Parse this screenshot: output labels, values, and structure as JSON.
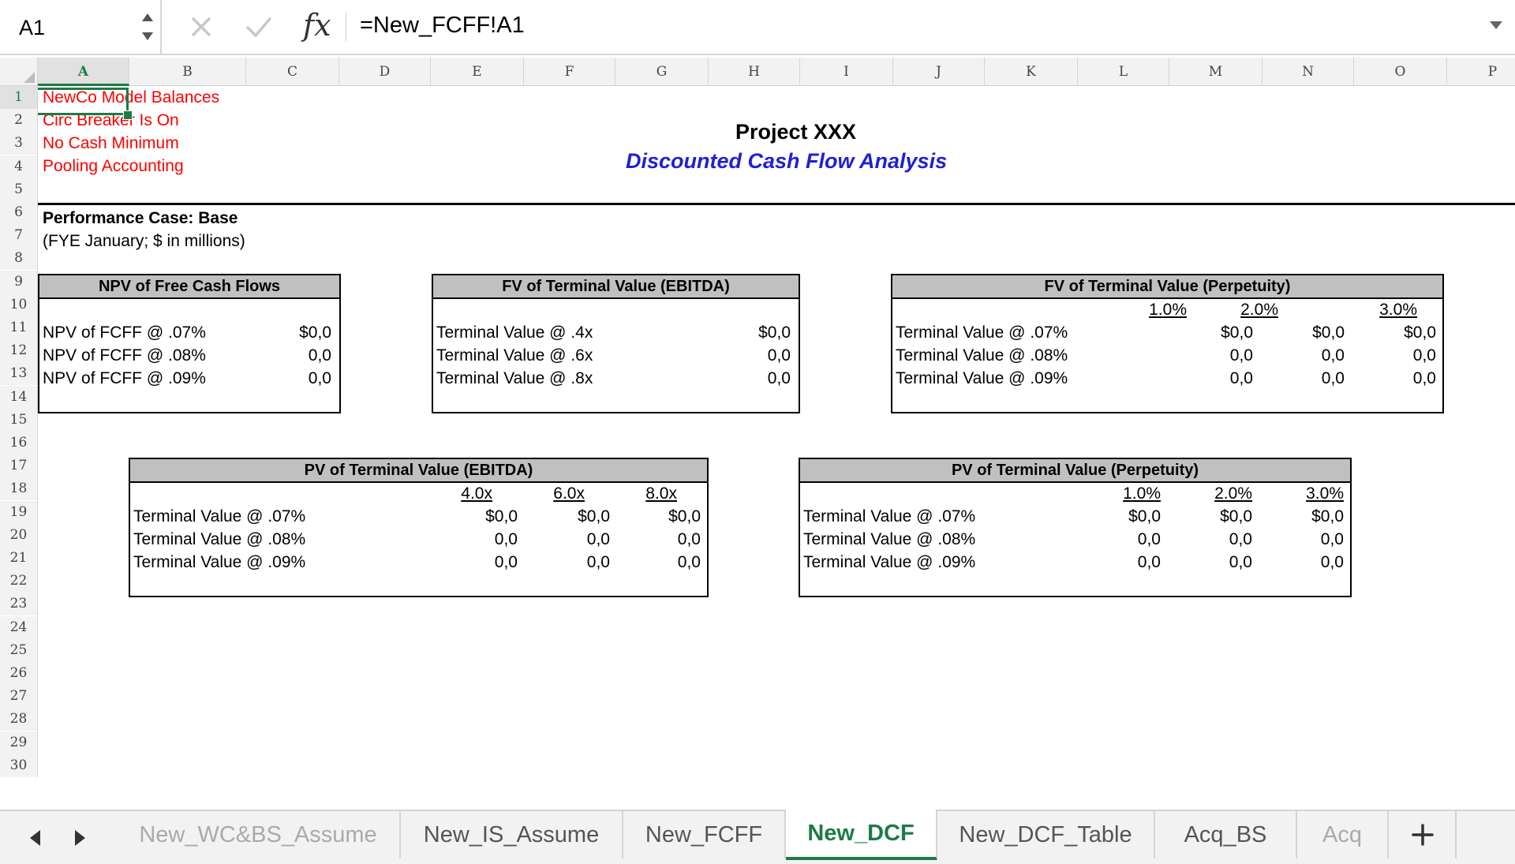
{
  "formula_bar": {
    "name_box": "A1",
    "formula": "=New_FCFF!A1",
    "fx_label": "fx"
  },
  "columns": [
    "A",
    "B",
    "C",
    "D",
    "E",
    "F",
    "G",
    "H",
    "I",
    "J",
    "K",
    "L",
    "M",
    "N",
    "O",
    "P"
  ],
  "rows": [
    "1",
    "2",
    "3",
    "4",
    "5",
    "6",
    "7",
    "8",
    "9",
    "10",
    "11",
    "12",
    "13",
    "14",
    "15",
    "16",
    "17",
    "18",
    "19",
    "20",
    "21",
    "22",
    "23",
    "24",
    "25",
    "26",
    "27",
    "28",
    "29",
    "30"
  ],
  "selected_cell": {
    "column": "A",
    "row": "1"
  },
  "header": {
    "line1": "NewCo Model Balances",
    "line2": "Circ Breaker Is On",
    "line3": "No Cash Minimum",
    "line4": "Pooling Accounting",
    "title": "Project XXX",
    "subtitle": "Discounted Cash Flow Analysis",
    "case": "Performance Case: Base",
    "units": "(FYE January; $ in millions)"
  },
  "npv_fcf": {
    "title": "NPV of Free Cash Flows",
    "rows": [
      {
        "label": "NPV of FCFF @ .07%",
        "value": "$0,0"
      },
      {
        "label": "NPV of FCFF @ .08%",
        "value": "0,0"
      },
      {
        "label": "NPV of FCFF @ .09%",
        "value": "0,0"
      }
    ]
  },
  "fv_tv_ebitda": {
    "title": "FV of Terminal Value (EBITDA)",
    "rows": [
      {
        "label": "Terminal Value @ .4x",
        "value": "$0,0"
      },
      {
        "label": "Terminal Value @ .6x",
        "value": "0,0"
      },
      {
        "label": "Terminal Value @ .8x",
        "value": "0,0"
      }
    ]
  },
  "fv_tv_perp": {
    "title": "FV of Terminal Value (Perpetuity)",
    "headers": [
      "1.0%",
      "2.0%",
      "3.0%"
    ],
    "rows": [
      {
        "label": "Terminal Value @ .07%",
        "values": [
          "$0,0",
          "$0,0",
          "$0,0"
        ]
      },
      {
        "label": "Terminal Value @ .08%",
        "values": [
          "0,0",
          "0,0",
          "0,0"
        ]
      },
      {
        "label": "Terminal Value @ .09%",
        "values": [
          "0,0",
          "0,0",
          "0,0"
        ]
      }
    ]
  },
  "pv_tv_ebitda": {
    "title": "PV of Terminal Value (EBITDA)",
    "headers": [
      "4.0x",
      "6.0x",
      "8.0x"
    ],
    "rows": [
      {
        "label": "Terminal Value @ .07%",
        "values": [
          "$0,0",
          "$0,0",
          "$0,0"
        ]
      },
      {
        "label": "Terminal Value @ .08%",
        "values": [
          "0,0",
          "0,0",
          "0,0"
        ]
      },
      {
        "label": "Terminal Value @ .09%",
        "values": [
          "0,0",
          "0,0",
          "0,0"
        ]
      }
    ]
  },
  "pv_tv_perp": {
    "title": "PV of Terminal Value (Perpetuity)",
    "headers": [
      "1.0%",
      "2.0%",
      "3.0%"
    ],
    "rows": [
      {
        "label": "Terminal Value @ .07%",
        "values": [
          "$0,0",
          "$0,0",
          "$0,0"
        ]
      },
      {
        "label": "Terminal Value @ .08%",
        "values": [
          "0,0",
          "0,0",
          "0,0"
        ]
      },
      {
        "label": "Terminal Value @ .09%",
        "values": [
          "0,0",
          "0,0",
          "0,0"
        ]
      }
    ]
  },
  "tabs": [
    "New_WC&BS_Assume",
    "New_IS_Assume",
    "New_FCFF",
    "New_DCF",
    "New_DCF_Table",
    "Acq_BS",
    "Acq"
  ],
  "active_tab": "New_DCF",
  "colors": {
    "accent": "#1d7b45",
    "warning": "#ff0000",
    "subtitle": "#1f1fd8",
    "box_header": "#c0c0c0"
  }
}
